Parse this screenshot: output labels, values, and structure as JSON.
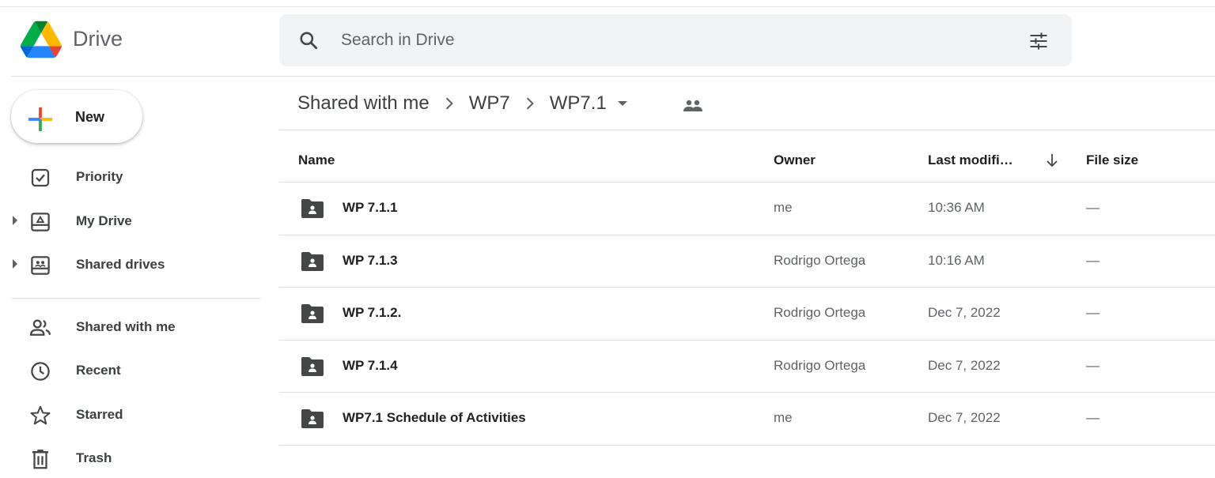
{
  "app": {
    "name": "Drive"
  },
  "search": {
    "placeholder": "Search in Drive"
  },
  "new_button": {
    "label": "New"
  },
  "sidebar": {
    "items": [
      {
        "label": "Priority",
        "icon": "priority-icon",
        "expandable": false
      },
      {
        "label": "My Drive",
        "icon": "my-drive-icon",
        "expandable": true
      },
      {
        "label": "Shared drives",
        "icon": "shared-drives-icon",
        "expandable": true
      },
      {
        "label": "Shared with me",
        "icon": "shared-with-me-icon",
        "expandable": false
      },
      {
        "label": "Recent",
        "icon": "clock-icon",
        "expandable": false
      },
      {
        "label": "Starred",
        "icon": "star-icon",
        "expandable": false
      },
      {
        "label": "Trash",
        "icon": "trash-icon",
        "expandable": false
      }
    ]
  },
  "breadcrumb": {
    "items": [
      "Shared with me",
      "WP7",
      "WP7.1"
    ]
  },
  "table": {
    "columns": {
      "name": "Name",
      "owner": "Owner",
      "modified": "Last modifi…",
      "size": "File size"
    },
    "rows": [
      {
        "name": "WP 7.1.1",
        "owner": "me",
        "modified": "10:36 AM",
        "size": "—"
      },
      {
        "name": "WP 7.1.3",
        "owner": "Rodrigo Ortega",
        "modified": "10:16 AM",
        "size": "—"
      },
      {
        "name": "WP 7.1.2.",
        "owner": "Rodrigo Ortega",
        "modified": "Dec 7, 2022",
        "size": "—"
      },
      {
        "name": "WP 7.1.4",
        "owner": "Rodrigo Ortega",
        "modified": "Dec 7, 2022",
        "size": "—"
      },
      {
        "name": "WP7.1 Schedule of Activities",
        "owner": "me",
        "modified": "Dec 7, 2022",
        "size": "—"
      }
    ]
  },
  "colors": {
    "accent_blue": "#4285f4",
    "accent_red": "#ea4335",
    "accent_yellow": "#fbbc04",
    "accent_green": "#34a853",
    "search_bg": "#f1f3f4",
    "folder_icon": "#444746"
  }
}
